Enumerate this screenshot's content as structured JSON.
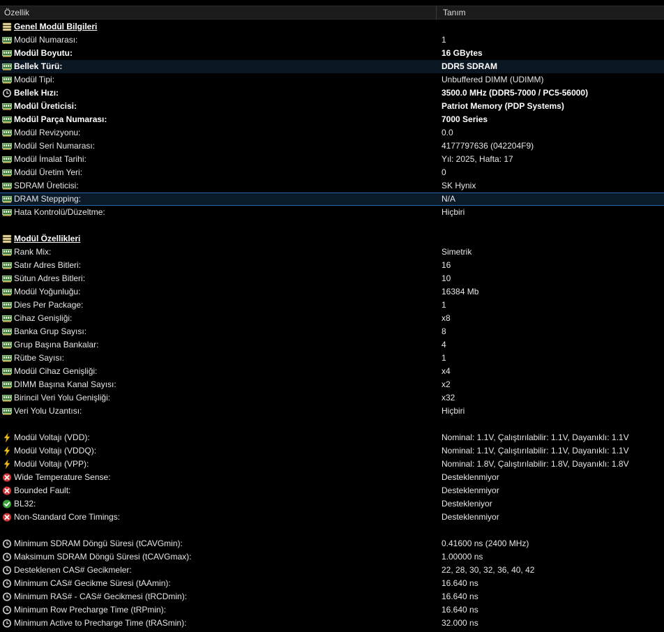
{
  "columns": {
    "property": "Özellik",
    "value": "Tanım"
  },
  "rows": [
    {
      "type": "section",
      "icon": "memory-stack-icon",
      "name": "Genel Modül Bilgileri"
    },
    {
      "type": "item",
      "icon": "ram-module-icon",
      "name": "Modül Numarası:",
      "value": "1"
    },
    {
      "type": "item",
      "icon": "ram-module-icon",
      "name": "Modül Boyutu:",
      "value": "16 GBytes",
      "bold": true
    },
    {
      "type": "item",
      "icon": "ram-module-icon",
      "name": "Bellek Türü:",
      "value": "DDR5 SDRAM",
      "bold": true,
      "highlight": true
    },
    {
      "type": "item",
      "icon": "ram-module-icon",
      "name": "Modül Tipi:",
      "value": "Unbuffered DIMM (UDIMM)"
    },
    {
      "type": "item",
      "icon": "clock-icon",
      "name": "Bellek Hızı:",
      "value": "3500.0 MHz (DDR5-7000 / PC5-56000)",
      "bold": true
    },
    {
      "type": "item",
      "icon": "ram-module-icon",
      "name": "Modül Üreticisi:",
      "value": "Patriot Memory (PDP Systems)",
      "bold": true
    },
    {
      "type": "item",
      "icon": "ram-module-icon",
      "name": "Modül Parça Numarası:",
      "value": "7000 Series",
      "bold": true
    },
    {
      "type": "item",
      "icon": "ram-module-icon",
      "name": "Modül Revizyonu:",
      "value": "0.0"
    },
    {
      "type": "item",
      "icon": "ram-module-icon",
      "name": "Modül Seri Numarası:",
      "value": "4177797636 (042204F9)"
    },
    {
      "type": "item",
      "icon": "ram-module-icon",
      "name": "Modül İmalat Tarihi:",
      "value": "Yıl: 2025, Hafta: 17"
    },
    {
      "type": "item",
      "icon": "ram-module-icon",
      "name": "Modül Üretim Yeri:",
      "value": "0"
    },
    {
      "type": "item",
      "icon": "ram-module-icon",
      "name": "SDRAM Üreticisi:",
      "value": "SK Hynix"
    },
    {
      "type": "item",
      "icon": "ram-module-icon",
      "name": "DRAM Steppping:",
      "value": "N/A",
      "selected": true
    },
    {
      "type": "item",
      "icon": "ram-module-icon",
      "name": "Hata Kontrolü/Düzeltme:",
      "value": "Hiçbiri"
    },
    {
      "type": "blank"
    },
    {
      "type": "section",
      "icon": "memory-stack-icon",
      "name": "Modül Özellikleri"
    },
    {
      "type": "item",
      "icon": "ram-module-icon",
      "name": "Rank Mix:",
      "value": "Simetrik"
    },
    {
      "type": "item",
      "icon": "ram-module-icon",
      "name": "Satır Adres Bitleri:",
      "value": "16"
    },
    {
      "type": "item",
      "icon": "ram-module-icon",
      "name": "Sütun Adres Bitleri:",
      "value": "10"
    },
    {
      "type": "item",
      "icon": "ram-module-icon",
      "name": "Modül Yoğunluğu:",
      "value": "16384 Mb"
    },
    {
      "type": "item",
      "icon": "ram-module-icon",
      "name": "Dies Per Package:",
      "value": "1"
    },
    {
      "type": "item",
      "icon": "ram-module-icon",
      "name": "Cihaz Genişliği:",
      "value": "x8"
    },
    {
      "type": "item",
      "icon": "ram-module-icon",
      "name": "Banka Grup Sayısı:",
      "value": "8"
    },
    {
      "type": "item",
      "icon": "ram-module-icon",
      "name": "Grup Başına Bankalar:",
      "value": "4"
    },
    {
      "type": "item",
      "icon": "ram-module-icon",
      "name": "Rütbe Sayısı:",
      "value": "1"
    },
    {
      "type": "item",
      "icon": "ram-module-icon",
      "name": "Modül Cihaz Genişliği:",
      "value": "x4"
    },
    {
      "type": "item",
      "icon": "ram-module-icon",
      "name": "DIMM Başına Kanal Sayısı:",
      "value": "x2"
    },
    {
      "type": "item",
      "icon": "ram-module-icon",
      "name": "Birincil Veri Yolu Genişliği:",
      "value": "x32"
    },
    {
      "type": "item",
      "icon": "ram-module-icon",
      "name": "Veri Yolu Uzantısı:",
      "value": "Hiçbiri"
    },
    {
      "type": "blank"
    },
    {
      "type": "item",
      "icon": "lightning-icon",
      "name": "Modül Voltajı (VDD):",
      "value": "Nominal: 1.1V, Çalıştırılabilir: 1.1V, Dayanıklı: 1.1V"
    },
    {
      "type": "item",
      "icon": "lightning-icon",
      "name": "Modül Voltajı (VDDQ):",
      "value": "Nominal: 1.1V, Çalıştırılabilir: 1.1V, Dayanıklı: 1.1V"
    },
    {
      "type": "item",
      "icon": "lightning-icon",
      "name": "Modül Voltajı (VPP):",
      "value": "Nominal: 1.8V, Çalıştırılabilir: 1.8V, Dayanıklı: 1.8V"
    },
    {
      "type": "item",
      "icon": "error-x-icon",
      "name": "Wide Temperature Sense:",
      "value": "Desteklenmiyor"
    },
    {
      "type": "item",
      "icon": "error-x-icon",
      "name": "Bounded Fault:",
      "value": "Desteklenmiyor"
    },
    {
      "type": "item",
      "icon": "check-icon",
      "name": "BL32:",
      "value": "Destekleniyor"
    },
    {
      "type": "item",
      "icon": "error-x-icon",
      "name": "Non-Standard Core Timings:",
      "value": "Desteklenmiyor"
    },
    {
      "type": "blank"
    },
    {
      "type": "item",
      "icon": "clock-icon",
      "name": "Minimum SDRAM Döngü Süresi (tCAVGmin):",
      "value": "0.41600 ns (2400 MHz)"
    },
    {
      "type": "item",
      "icon": "clock-icon",
      "name": "Maksimum SDRAM Döngü Süresi (tCAVGmax):",
      "value": "1.00000 ns"
    },
    {
      "type": "item",
      "icon": "clock-icon",
      "name": "Desteklenen CAS# Gecikmeler:",
      "value": "22, 28, 30, 32, 36, 40, 42"
    },
    {
      "type": "item",
      "icon": "clock-icon",
      "name": "Minimum CAS# Gecikme Süresi (tAAmin):",
      "value": "16.640 ns"
    },
    {
      "type": "item",
      "icon": "clock-icon",
      "name": "Minimum RAS# - CAS# Gecikmesi (tRCDmin):",
      "value": "16.640 ns"
    },
    {
      "type": "item",
      "icon": "clock-icon",
      "name": "Minimum Row Precharge Time (tRPmin):",
      "value": "16.640 ns"
    },
    {
      "type": "item",
      "icon": "clock-icon",
      "name": "Minimum Active to Precharge Time (tRASmin):",
      "value": "32.000 ns"
    }
  ]
}
